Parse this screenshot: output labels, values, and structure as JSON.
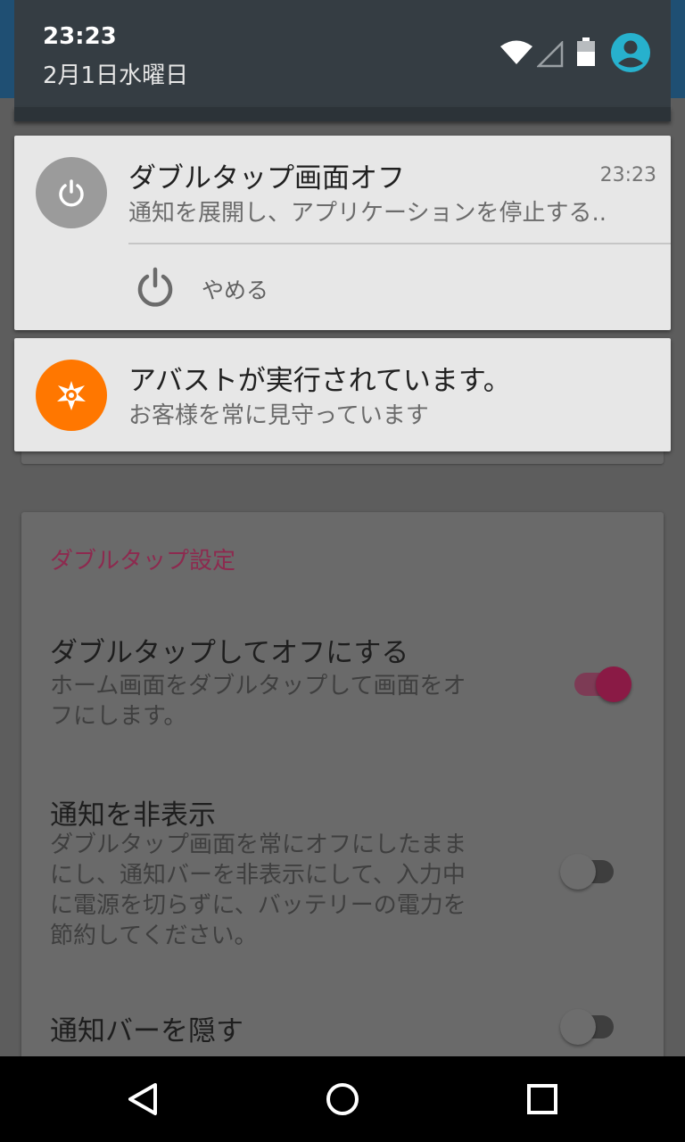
{
  "status_bar": {
    "time": "23:23",
    "date": "2月1日水曜日",
    "icons": [
      "wifi-icon",
      "cell-signal-icon",
      "battery-icon",
      "user-account-icon"
    ],
    "accent_color": "#27b1cd"
  },
  "notifications": [
    {
      "app_icon": "power-icon",
      "title": "ダブルタップ画面オフ",
      "time": "23:23",
      "text": "通知を展開し、アプリケーションを停止する..",
      "action": {
        "icon": "power-icon",
        "label": "やめる"
      }
    },
    {
      "app_icon": "avast-icon",
      "title": "アバストが実行されています。",
      "text": "お客様を常に見守っています",
      "icon_color": "#ff7700"
    }
  ],
  "settings": {
    "section_title": "ダブルタップ設定",
    "accent_color": "#8a1a45",
    "items": [
      {
        "title": "ダブルタップしてオフにする",
        "summary_lines": [
          "ホーム画面をダブルタップして画面をオ",
          "フにします。"
        ],
        "toggle": true
      },
      {
        "title": "通知を非表示",
        "summary_lines": [
          "ダブルタップ画面を常にオフにしたまま",
          "にし、通知バーを非表示にして、入力中",
          "に電源を切らずに、バッテリーの電力を",
          "節約してください。"
        ],
        "toggle": false
      },
      {
        "title": "通知バーを隠す",
        "summary_lines": [],
        "toggle": false
      }
    ]
  },
  "nav_bar": {
    "buttons": [
      "back-icon",
      "home-icon",
      "recents-icon"
    ]
  }
}
